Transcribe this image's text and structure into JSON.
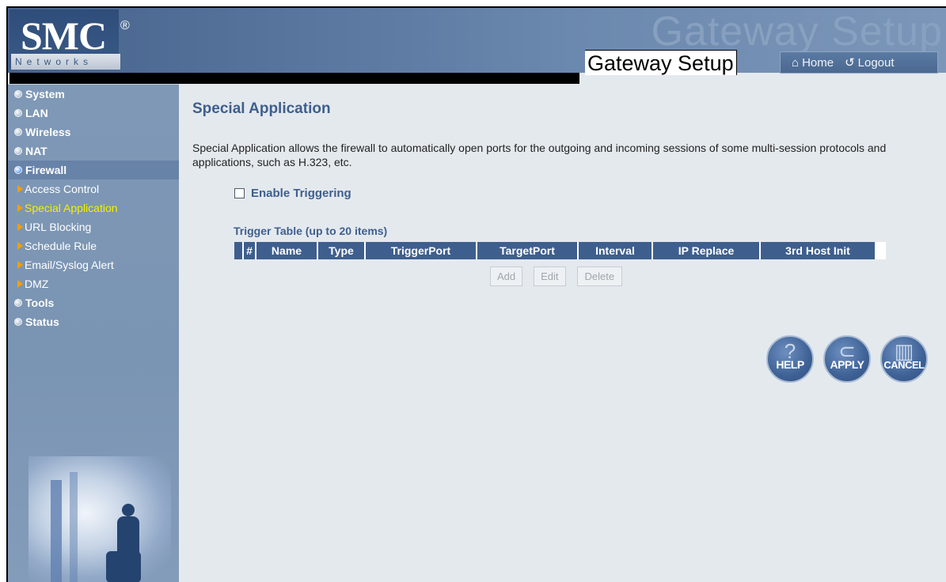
{
  "header": {
    "logo_text": "SMC",
    "logo_reg": "®",
    "logo_sub": "Networks",
    "ghost_title": "Gateway Setup",
    "title": "Gateway Setup",
    "home_label": "Home",
    "logout_label": "Logout"
  },
  "sidebar": {
    "items": [
      {
        "label": "System"
      },
      {
        "label": "LAN"
      },
      {
        "label": "Wireless"
      },
      {
        "label": "NAT"
      },
      {
        "label": "Firewall"
      },
      {
        "label": "Tools"
      },
      {
        "label": "Status"
      }
    ],
    "subitems": [
      {
        "label": "Access Control"
      },
      {
        "label": "Special Application"
      },
      {
        "label": "URL Blocking"
      },
      {
        "label": "Schedule Rule"
      },
      {
        "label": "Email/Syslog Alert"
      },
      {
        "label": "DMZ"
      }
    ]
  },
  "main": {
    "title": "Special Application",
    "description": "Special Application allows the firewall to automatically open ports for the outgoing and incoming sessions of some multi-session protocols and applications, such as H.323, etc.",
    "enable_label": "Enable Triggering",
    "table_caption": "Trigger Table (up to 20 items)",
    "columns": [
      "#",
      "Name",
      "Type",
      "TriggerPort",
      "TargetPort",
      "Interval",
      "IP Replace",
      "3rd Host Init"
    ],
    "buttons": {
      "add": "Add",
      "edit": "Edit",
      "delete": "Delete"
    },
    "round_buttons": {
      "help": "HELP",
      "apply": "APPLY",
      "cancel": "CANCEL"
    }
  },
  "colors": {
    "accent": "#3e5f8e",
    "sidebar_bg": "#7f98b6",
    "current_item": "#f4f000",
    "content_bg": "#e4e9ee"
  }
}
